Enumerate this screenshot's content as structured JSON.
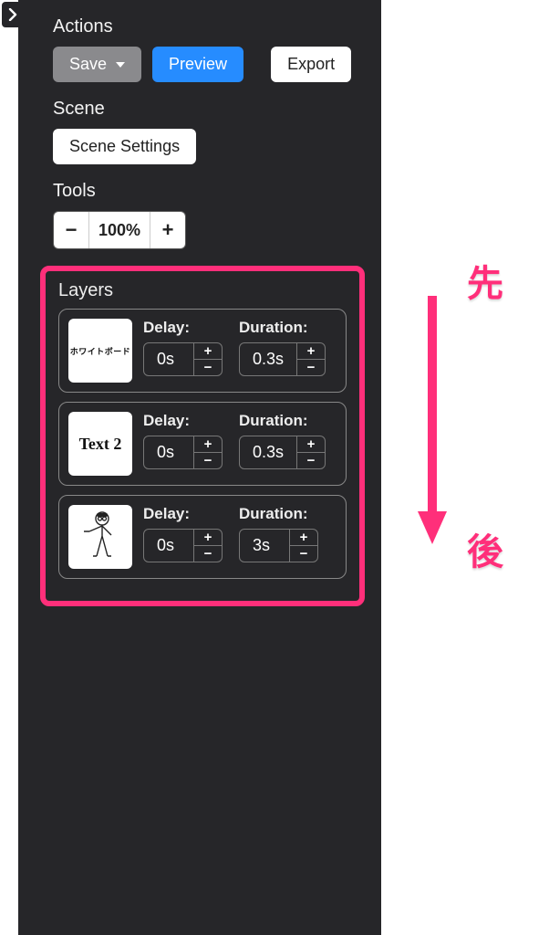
{
  "sections": {
    "actions": "Actions",
    "scene": "Scene",
    "tools": "Tools",
    "layers": "Layers"
  },
  "buttons": {
    "save": "Save",
    "preview": "Preview",
    "export": "Export",
    "scene_settings": "Scene Settings"
  },
  "zoom": {
    "value": "100%"
  },
  "field_labels": {
    "delay": "Delay:",
    "duration": "Duration:"
  },
  "layers": [
    {
      "thumb_text": "ホワイトボード",
      "delay": "0s",
      "duration": "0.3s"
    },
    {
      "thumb_text": "Text 2",
      "delay": "0s",
      "duration": "0.3s"
    },
    {
      "thumb_text": "",
      "delay": "0s",
      "duration": "3s"
    }
  ],
  "annotation": {
    "first": "先",
    "last": "後"
  },
  "colors": {
    "highlight": "#ff2f7a",
    "panel_bg": "#262629",
    "primary_btn": "#268cff"
  }
}
